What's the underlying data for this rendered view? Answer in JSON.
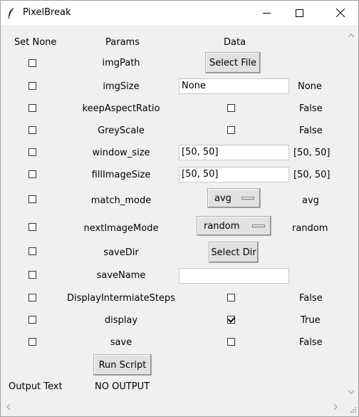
{
  "window": {
    "title": "PixelBreak",
    "icons": {
      "app": "feather-icon",
      "minimize": "minimize-icon",
      "maximize": "maximize-icon",
      "close": "close-icon"
    }
  },
  "headers": {
    "set_none": "Set None",
    "params": "Params",
    "data": "Data"
  },
  "rows": [
    {
      "param": "imgPath",
      "control": "button",
      "control_label": "Select File",
      "value": "",
      "checked": false
    },
    {
      "param": "imgSize",
      "control": "entry",
      "entry_value": "None",
      "value": "None",
      "checked": false
    },
    {
      "param": "keepAspectRatio",
      "control": "checkbox",
      "data_checked": false,
      "value": "False",
      "checked": false
    },
    {
      "param": "GreyScale",
      "control": "checkbox",
      "data_checked": false,
      "value": "False",
      "checked": false
    },
    {
      "param": "window_size",
      "control": "entry",
      "entry_value": "[50, 50]",
      "value": "[50, 50]",
      "checked": false
    },
    {
      "param": "fillImageSize",
      "control": "entry",
      "entry_value": "[50, 50]",
      "value": "[50, 50]",
      "checked": false
    },
    {
      "param": "match_mode",
      "control": "optionmenu",
      "selected": "avg",
      "value": "avg",
      "checked": false
    },
    {
      "param": "nextImageMode",
      "control": "optionmenu",
      "selected": "random",
      "value": "random",
      "checked": false
    },
    {
      "param": "saveDir",
      "control": "button",
      "control_label": "Select Dir",
      "value": "",
      "checked": false
    },
    {
      "param": "saveName",
      "control": "entry",
      "entry_value": "",
      "value": "",
      "checked": false
    },
    {
      "param": "DisplayIntermiateSteps",
      "control": "checkbox",
      "data_checked": false,
      "value": "False",
      "checked": false
    },
    {
      "param": "display",
      "control": "checkbox",
      "data_checked": true,
      "value": "True",
      "checked": false
    },
    {
      "param": "save",
      "control": "checkbox",
      "data_checked": false,
      "value": "False",
      "checked": false
    }
  ],
  "run_button": "Run Script",
  "output": {
    "label": "Output Text",
    "text": "NO OUTPUT"
  }
}
